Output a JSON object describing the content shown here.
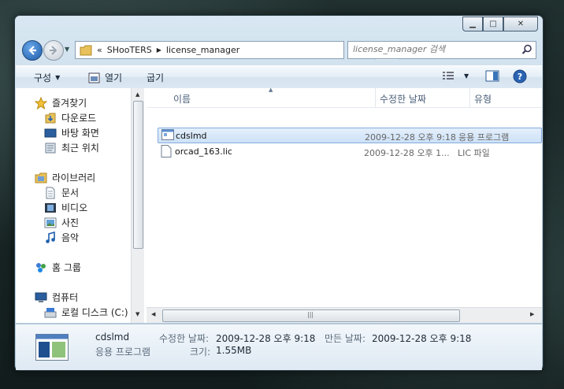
{
  "address": {
    "overflow": "«",
    "segments": [
      "SHooTERS",
      "license_manager"
    ]
  },
  "search": {
    "placeholder": "license_manager 검색"
  },
  "toolbar": {
    "organize": "구성",
    "open": "열기",
    "burn": "굽기"
  },
  "nav": {
    "favorites": "즐겨찾기",
    "downloads": "다운로드",
    "desktop": "바탕 화면",
    "recent": "최근 위치",
    "libraries": "라이브러리",
    "documents": "문서",
    "videos": "비디오",
    "pictures": "사진",
    "music": "음악",
    "homegroup": "홈 그룹",
    "computer": "컴퓨터",
    "local_disk": "로컬 디스크 (C:)"
  },
  "columns": {
    "name": "이름",
    "date": "수정한 날짜",
    "type": "유형"
  },
  "files": [
    {
      "name": "cdslmd",
      "date": "2009-12-28 오후 9:18",
      "type": "응용 프로그램"
    },
    {
      "name": "orcad_163.lic",
      "date": "2009-12-28 오후 1...",
      "type": "LIC 파일"
    }
  ],
  "details": {
    "name": "cdslmd",
    "kind": "응용 프로그램",
    "modified_label": "수정한 날짜:",
    "modified": "2009-12-28 오후 9:18",
    "created_label": "만든 날짜:",
    "created": "2009-12-28 오후 9:18",
    "size_label": "크기:",
    "size": "1.55MB"
  },
  "colors": {
    "accent": "#1c5aa8",
    "selection": "#cde1f7"
  }
}
